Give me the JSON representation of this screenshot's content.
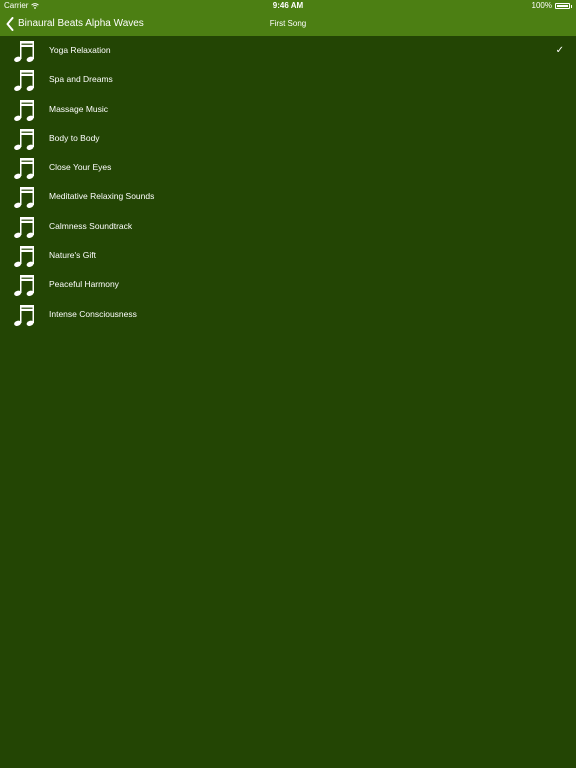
{
  "status_bar": {
    "carrier": "Carrier",
    "time": "9:46 AM",
    "battery_percent": "100%",
    "icons": [
      "wifi-icon",
      "battery-icon"
    ]
  },
  "nav": {
    "back_label": "Binaural Beats Alpha Waves",
    "title": "First Song"
  },
  "songs": [
    {
      "label": "Yoga Relaxation",
      "selected": true
    },
    {
      "label": "Spa and Dreams",
      "selected": false
    },
    {
      "label": "Massage Music",
      "selected": false
    },
    {
      "label": "Body to Body",
      "selected": false
    },
    {
      "label": "Close Your Eyes",
      "selected": false
    },
    {
      "label": "Meditative Relaxing Sounds",
      "selected": false
    },
    {
      "label": "Calmness Soundtrack",
      "selected": false
    },
    {
      "label": "Nature's Gift",
      "selected": false
    },
    {
      "label": "Peaceful Harmony",
      "selected": false
    },
    {
      "label": "Intense Consciousness",
      "selected": false
    }
  ],
  "checkmark": "✓",
  "colors": {
    "background": "#234504",
    "nav_bar": "#4c7f13",
    "text": "#ffffff"
  }
}
